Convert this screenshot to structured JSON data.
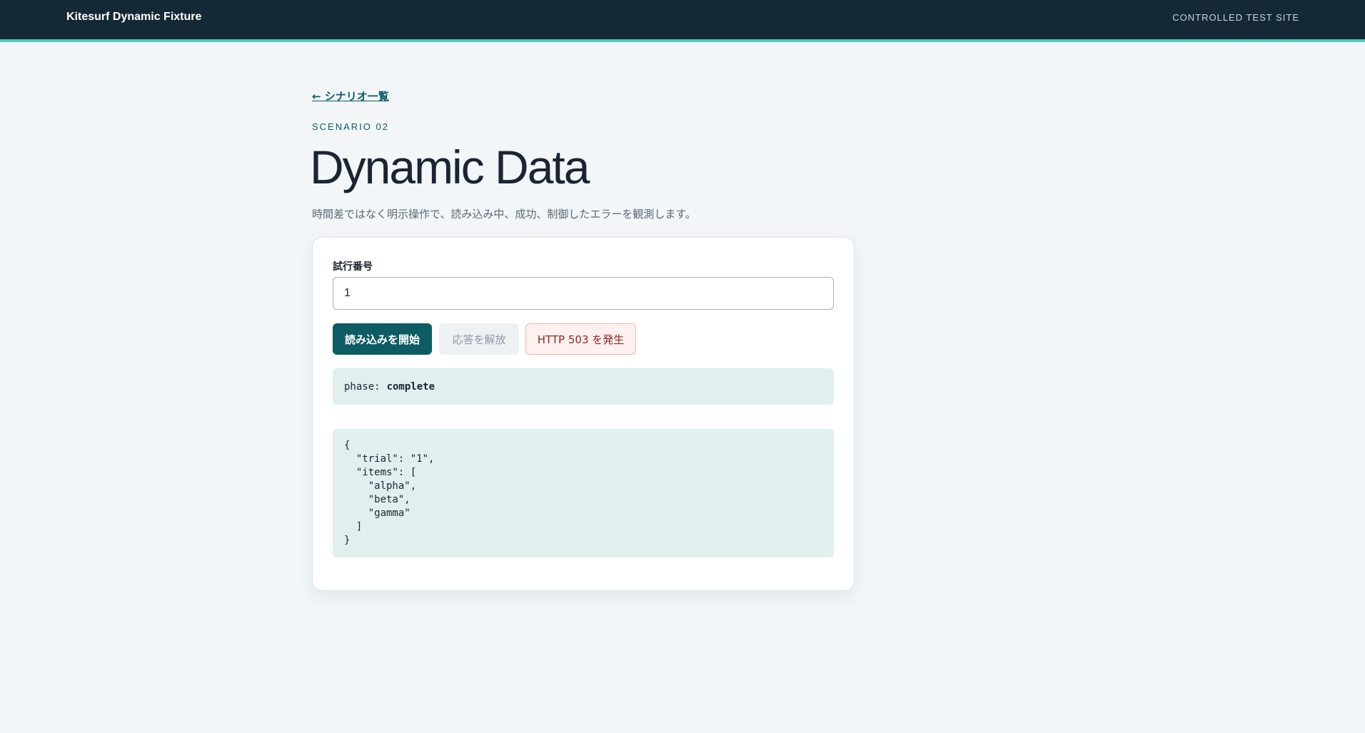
{
  "header": {
    "brand": "Kitesurf Dynamic Fixture",
    "site_tag": "CONTROLLED TEST SITE"
  },
  "nav": {
    "back_label": "← シナリオ一覧"
  },
  "page": {
    "eyebrow": "SCENARIO 02",
    "title": "Dynamic Data",
    "subtitle": "時間差ではなく明示操作で、読み込み中、成功、制御したエラーを観測します。"
  },
  "form": {
    "trial_label": "試行番号",
    "trial_value": "1"
  },
  "actions": {
    "start_label": "読み込みを開始",
    "release_label": "応答を解放",
    "error_label": "HTTP 503 を発生",
    "release_disabled": true
  },
  "status": {
    "phase_label": "phase:",
    "phase_value": "complete"
  },
  "response": {
    "json_text": "{\n  \"trial\": \"1\",\n  \"items\": [\n    \"alpha\",\n    \"beta\",\n    \"gamma\"\n  ]\n}"
  },
  "colors": {
    "header_bg": "#142935",
    "accent": "#4fc7b8",
    "primary": "#0d5c63",
    "error_text": "#8c2a1f",
    "panel_bg": "#dff0ee"
  }
}
